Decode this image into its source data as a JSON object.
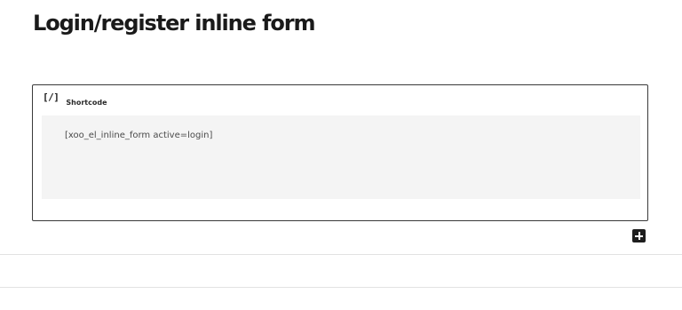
{
  "page": {
    "title": "Login/register inline form"
  },
  "block": {
    "icon": "[/]",
    "icon_name": "shortcode-icon",
    "label": "Shortcode",
    "shortcode_value": "[xoo_el_inline_form active=login]"
  },
  "toolbar": {
    "add_icon": "plus-icon"
  },
  "colors": {
    "title": "#1a1a1a",
    "block_border": "#3a3a3a",
    "code_background": "#f4f4f4",
    "add_button": "#1e1e1e"
  }
}
